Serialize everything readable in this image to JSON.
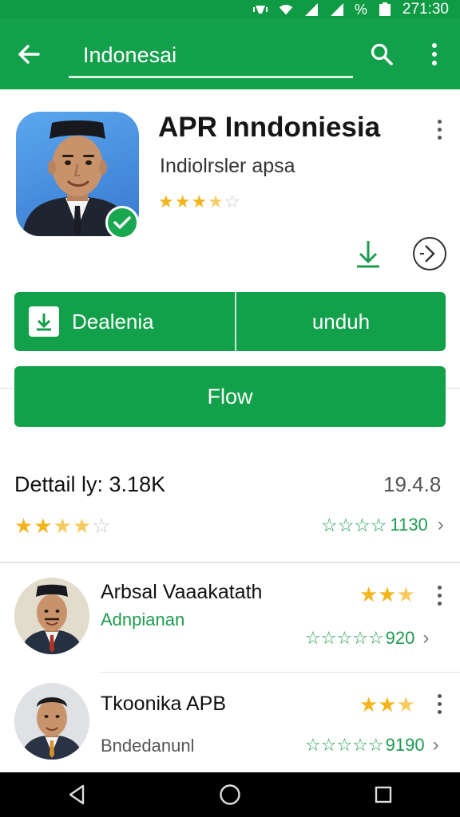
{
  "status_bar": {
    "time": "271:30",
    "battery_text": "%"
  },
  "search": {
    "value": "Indonesai"
  },
  "app": {
    "title": "APR Inndoniesia",
    "subtitle": "Indiolrsler apsa",
    "rating_stars": 3.5,
    "rating_max": 5,
    "icon_name": "portrait-man-peci",
    "verified_icon": "check-badge-icon"
  },
  "actions": {
    "primary_left_label": "Dealenia",
    "primary_right_label": "unduh",
    "follow_label": "Flow"
  },
  "details": {
    "title": "Dettail ly: 3.18K",
    "version": "19.4.8",
    "rating_stars": 3.5,
    "reviews_count": "1130"
  },
  "list": [
    {
      "name": "Arbsal Vaaakatath",
      "subtitle": "Adnpianan",
      "subtitle_color": "#1d9b4e",
      "rating": "3.5",
      "reviews": "920"
    },
    {
      "name": "Tkoonika APB",
      "subtitle": "Bndedanunl",
      "subtitle_color": "#555555",
      "rating": "2.5",
      "reviews": "9190"
    }
  ],
  "colors": {
    "primary": "#12a14a",
    "star": "#f3b51b",
    "accent_text": "#1d9b4e"
  }
}
